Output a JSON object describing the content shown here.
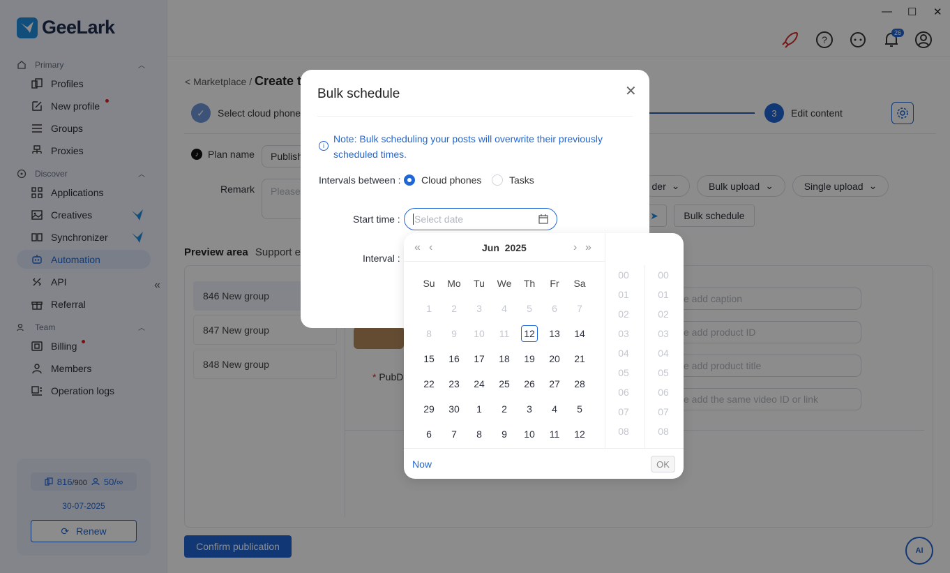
{
  "app": {
    "name": "GeeLark"
  },
  "sidebar": {
    "sections": [
      {
        "label": "Primary"
      },
      {
        "label": "Discover"
      },
      {
        "label": "Team"
      }
    ],
    "items": [
      {
        "label": "Profiles"
      },
      {
        "label": "New profile"
      },
      {
        "label": "Groups"
      },
      {
        "label": "Proxies"
      },
      {
        "label": "Applications"
      },
      {
        "label": "Creatives"
      },
      {
        "label": "Synchronizer"
      },
      {
        "label": "Automation"
      },
      {
        "label": "API"
      },
      {
        "label": "Referral"
      },
      {
        "label": "Billing"
      },
      {
        "label": "Members"
      },
      {
        "label": "Operation logs"
      }
    ],
    "account": {
      "phones_used": "816",
      "phones_total": "/900",
      "members_used": "50/",
      "members_total": "∞",
      "expiry": "30-07-2025",
      "renew_label": "Renew"
    }
  },
  "header": {
    "notifications": "26"
  },
  "page": {
    "breadcrumb_parent": "< Marketplace /",
    "breadcrumb_current": "Create t",
    "steps": [
      {
        "label": "Select cloud phones"
      },
      {
        "number": "3",
        "label": "Edit content"
      }
    ],
    "plan_name_label": "Plan name",
    "plan_name_value": "Publish",
    "remark_label": "Remark",
    "remark_placeholder": "Please e",
    "upload_buttons": [
      "der",
      "Bulk upload",
      "Single upload"
    ],
    "bulk_schedule_label": "Bulk schedule",
    "preview_title": "Preview area",
    "preview_sub": "Support e",
    "groups": [
      "846 New group",
      "847 New group",
      "848 New group"
    ],
    "form_placeholders": [
      "se add caption",
      "se add product ID",
      "se add product title",
      "se add the same video ID or link"
    ],
    "pubdate_label": "PubD",
    "confirm_label": "Confirm publication"
  },
  "modal": {
    "title": "Bulk schedule",
    "note": "Note: Bulk scheduling your posts will overwrite their previously scheduled times.",
    "intervals_label": "Intervals between",
    "options": [
      "Cloud phones",
      "Tasks"
    ],
    "selected_option": "Cloud phones",
    "start_time_label": "Start time",
    "start_time_placeholder": "Select date",
    "interval_label": "Interval"
  },
  "picker": {
    "month": "Jun",
    "year": "2025",
    "weekdays": [
      "Su",
      "Mo",
      "Tu",
      "We",
      "Th",
      "Fr",
      "Sa"
    ],
    "days": [
      [
        "1",
        "2",
        "3",
        "4",
        "5",
        "6",
        "7"
      ],
      [
        "8",
        "9",
        "10",
        "11",
        "12",
        "13",
        "14"
      ],
      [
        "15",
        "16",
        "17",
        "18",
        "19",
        "20",
        "21"
      ],
      [
        "22",
        "23",
        "24",
        "25",
        "26",
        "27",
        "28"
      ],
      [
        "29",
        "30",
        "1",
        "2",
        "3",
        "4",
        "5"
      ],
      [
        "6",
        "7",
        "8",
        "9",
        "10",
        "11",
        "12"
      ]
    ],
    "today": "12",
    "hours": [
      "00",
      "01",
      "02",
      "03",
      "04",
      "05",
      "06",
      "07",
      "08"
    ],
    "minutes": [
      "00",
      "01",
      "02",
      "03",
      "04",
      "05",
      "06",
      "07",
      "08"
    ],
    "now_label": "Now",
    "ok_label": "OK"
  },
  "colors": {
    "accent": "#1f66d6",
    "alert": "#e02020",
    "brand_dark": "#1f2d4d"
  }
}
